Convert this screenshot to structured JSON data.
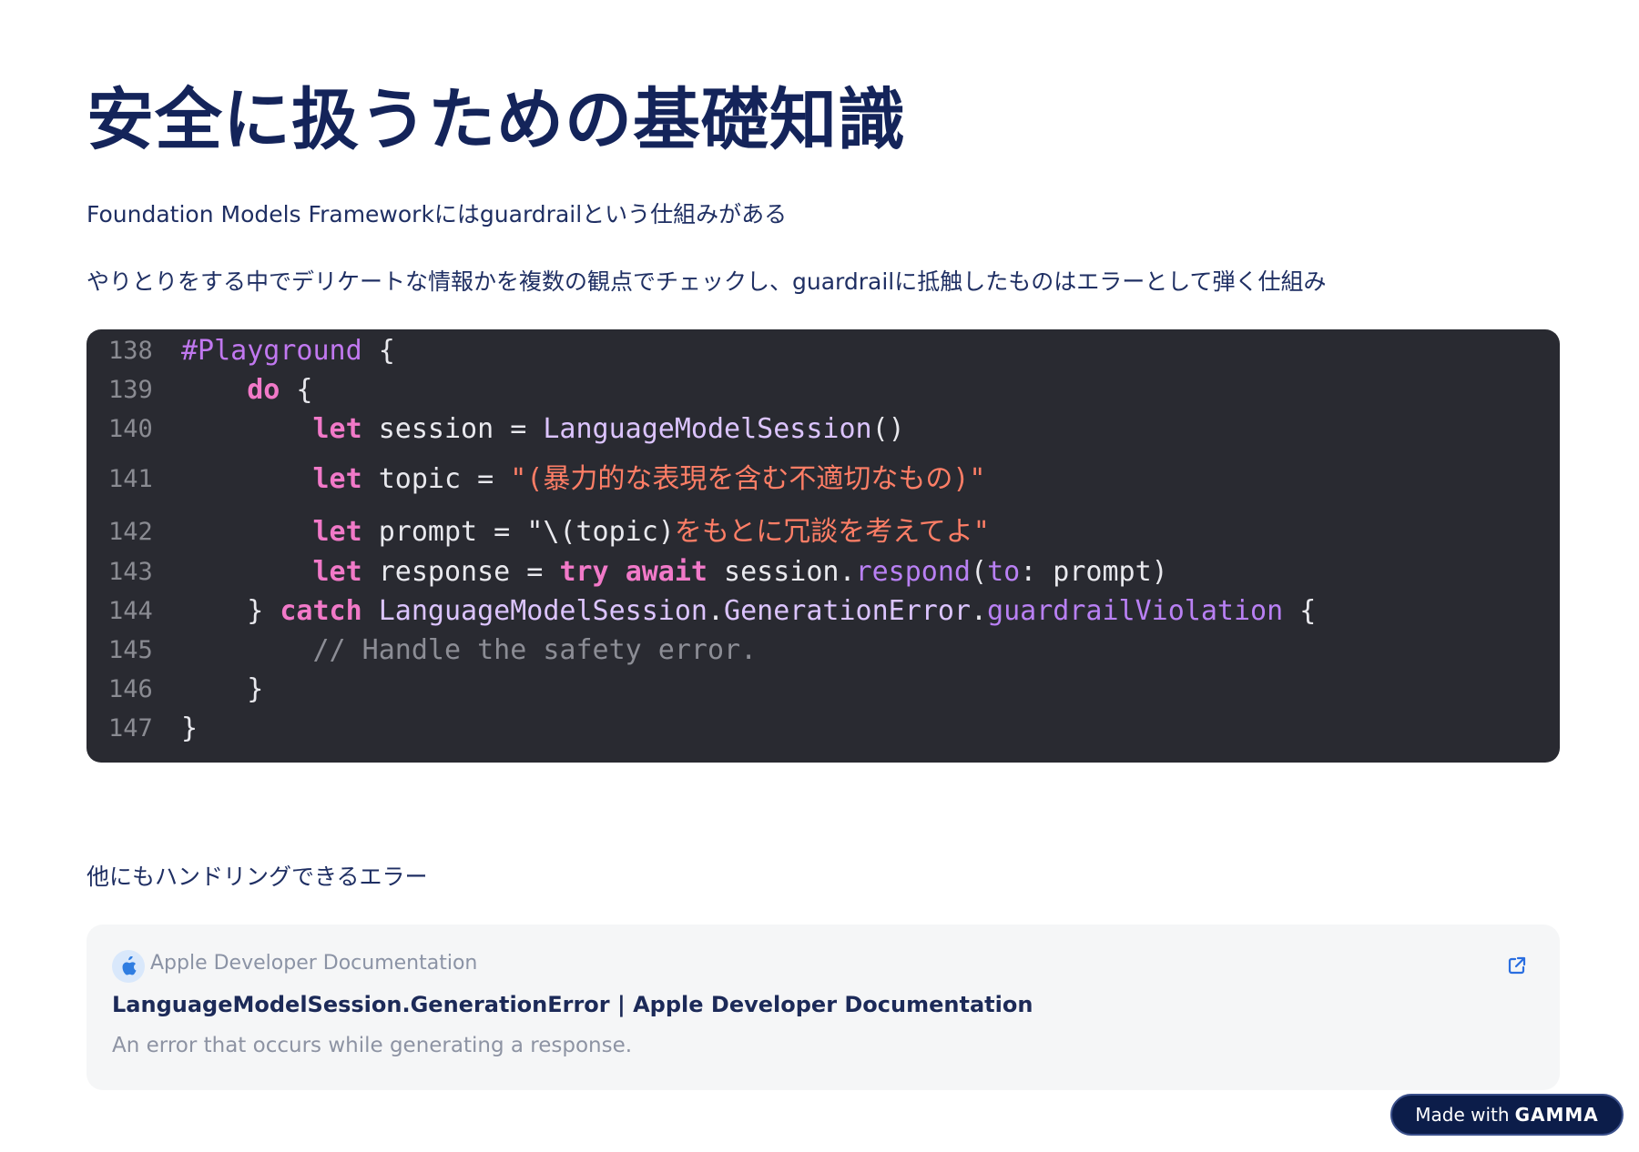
{
  "title": "安全に扱うための基礎知識",
  "paragraph1": "Foundation Models Frameworkにはguardrailという仕組みがある",
  "paragraph2": "やりとりをする中でデリケートな情報かを複数の観点でチェックし、guardrailに抵触したものはエラーとして弾く仕組み",
  "code": {
    "lines": [
      {
        "num": "138",
        "parts": [
          [
            "dir",
            "#Playground"
          ],
          [
            "",
            " {"
          ]
        ]
      },
      {
        "num": "139",
        "parts": [
          [
            "",
            "    "
          ],
          [
            "kw",
            "do"
          ],
          [
            "",
            " {"
          ]
        ]
      },
      {
        "num": "140",
        "parts": [
          [
            "",
            "        "
          ],
          [
            "kw",
            "let"
          ],
          [
            "",
            " session = "
          ],
          [
            "type",
            "LanguageModelSession"
          ],
          [
            "",
            "()"
          ]
        ]
      },
      {
        "num": "141",
        "parts": [
          [
            "",
            "        "
          ],
          [
            "kw",
            "let"
          ],
          [
            "",
            " topic = "
          ],
          [
            "str",
            "\"(暴力的な表現を含む不適切なもの)\""
          ]
        ]
      },
      {
        "num": "142",
        "parts": [
          [
            "",
            "        "
          ],
          [
            "kw",
            "let"
          ],
          [
            "",
            " prompt = "
          ],
          [
            "",
            "\"\\(topic)"
          ],
          [
            "str",
            "をもとに冗談を考えてよ\""
          ]
        ]
      },
      {
        "num": "143",
        "parts": [
          [
            "",
            "        "
          ],
          [
            "kw",
            "let"
          ],
          [
            "",
            " response = "
          ],
          [
            "kw",
            "try"
          ],
          [
            "",
            " "
          ],
          [
            "kw",
            "await"
          ],
          [
            "",
            " session."
          ],
          [
            "fn",
            "respond"
          ],
          [
            "",
            "("
          ],
          [
            "fn",
            "to"
          ],
          [
            "",
            ": prompt)"
          ]
        ]
      },
      {
        "num": "144",
        "parts": [
          [
            "",
            "    } "
          ],
          [
            "kw",
            "catch"
          ],
          [
            "",
            " "
          ],
          [
            "type",
            "LanguageModelSession"
          ],
          [
            "",
            "."
          ],
          [
            "type",
            "GenerationError"
          ],
          [
            "",
            "."
          ],
          [
            "fn",
            "guardrailViolation"
          ],
          [
            "",
            " {"
          ]
        ]
      },
      {
        "num": "145",
        "parts": [
          [
            "",
            "        "
          ],
          [
            "cm",
            "// Handle the safety error."
          ]
        ]
      },
      {
        "num": "146",
        "parts": [
          [
            "",
            "    }"
          ]
        ]
      },
      {
        "num": "147",
        "parts": [
          [
            "",
            "}"
          ]
        ]
      }
    ]
  },
  "paragraph3": "他にもハンドリングできるエラー",
  "link_card": {
    "source": "Apple Developer Documentation",
    "title": "LanguageModelSession.GenerationError | Apple Developer Documentation",
    "description": "An error that occurs while generating a response.",
    "icon": "external-link-icon"
  },
  "badge": {
    "prefix": "Made with",
    "brand": "GAMMA"
  }
}
